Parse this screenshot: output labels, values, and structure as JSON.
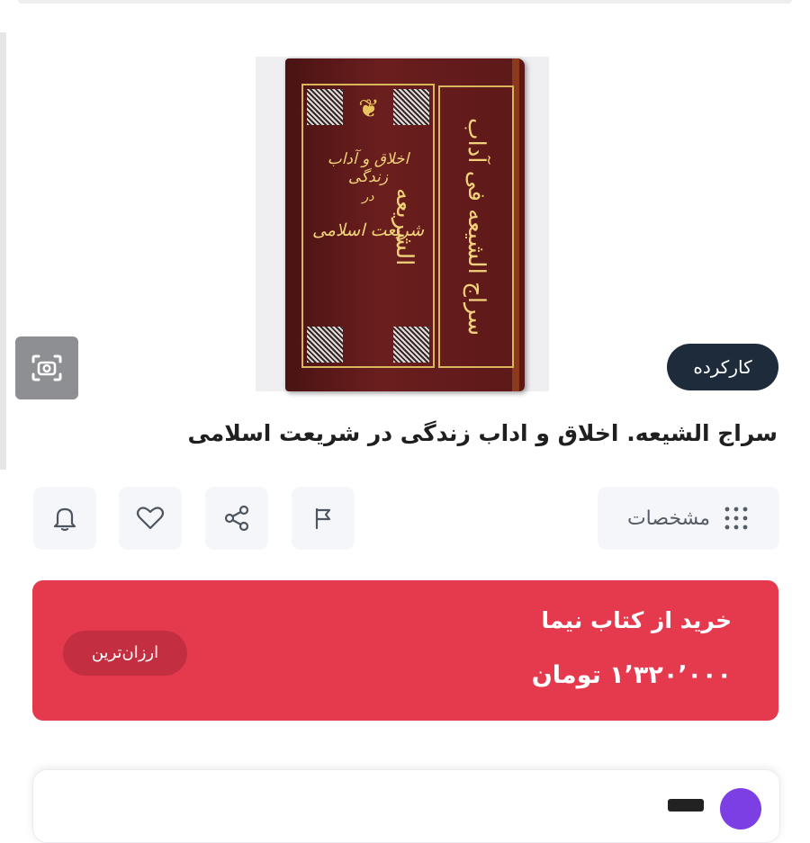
{
  "product": {
    "condition_badge": "کارکرده",
    "title": "سراج الشیعه. اخلاق و اداب زندگی در شریعت اسلامی",
    "cover": {
      "line1": "اخلاق و آداب زندگی",
      "line2": "در",
      "line3": "شریعت اسلامی",
      "side_title": "سراج الشیعه فی آداب الشریعه"
    }
  },
  "actions": {
    "specs_label": "مشخصات"
  },
  "buy": {
    "seller": "خرید از کتاب نیما",
    "price": "۱٬۳۲۰٬۰۰۰ تومان",
    "cheapest_badge": "ارزان‌ترین"
  },
  "colors": {
    "buy_card": "#e53a4e",
    "badge_dark": "#1d2b3a",
    "accent_purple": "#7b3fe4"
  },
  "icons": {
    "camera": "camera-search-icon",
    "flag": "flag-icon",
    "share": "share-icon",
    "heart": "heart-icon",
    "bell": "bell-icon",
    "grid": "grid-dots-icon"
  }
}
